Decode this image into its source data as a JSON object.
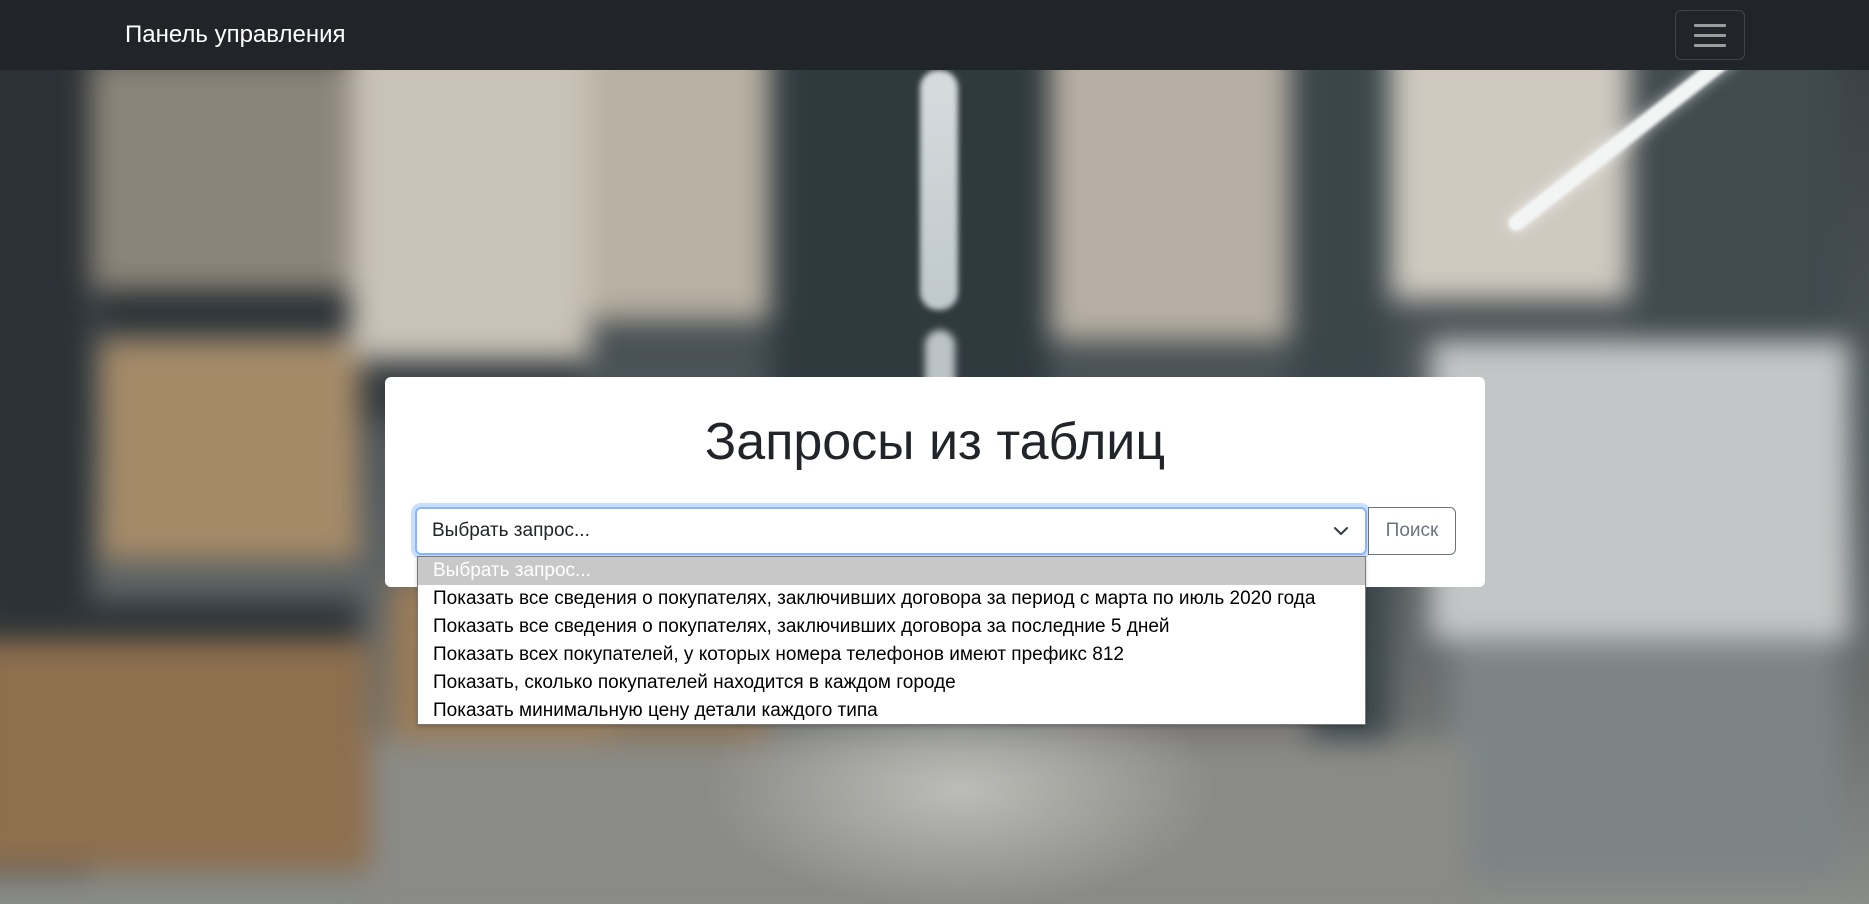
{
  "navbar": {
    "brand": "Панель управления",
    "toggler_icon": "hamburger-icon"
  },
  "card": {
    "title": "Запросы из таблиц",
    "select": {
      "value": "Выбрать запрос...",
      "chevron_icon": "chevron-down-icon"
    },
    "search_button": "Поиск"
  },
  "dropdown": {
    "options": [
      "Выбрать запрос...",
      "Показать все сведения о покупателях, заключивших договора за период с марта по июль 2020 года",
      "Показать все сведения о покупателях, заключивших договора за последние 5 дней",
      "Показать всех покупателей, у которых номера телефонов имеют префикс 812",
      "Показать, сколько покупателей находится в каждом городе",
      "Показать минимальную цену детали каждого типа"
    ],
    "selected_index": 0
  },
  "colors": {
    "navbar_bg": "#212529",
    "focus_border": "#86b7fe",
    "selected_option_bg": "#c8c8c8"
  }
}
